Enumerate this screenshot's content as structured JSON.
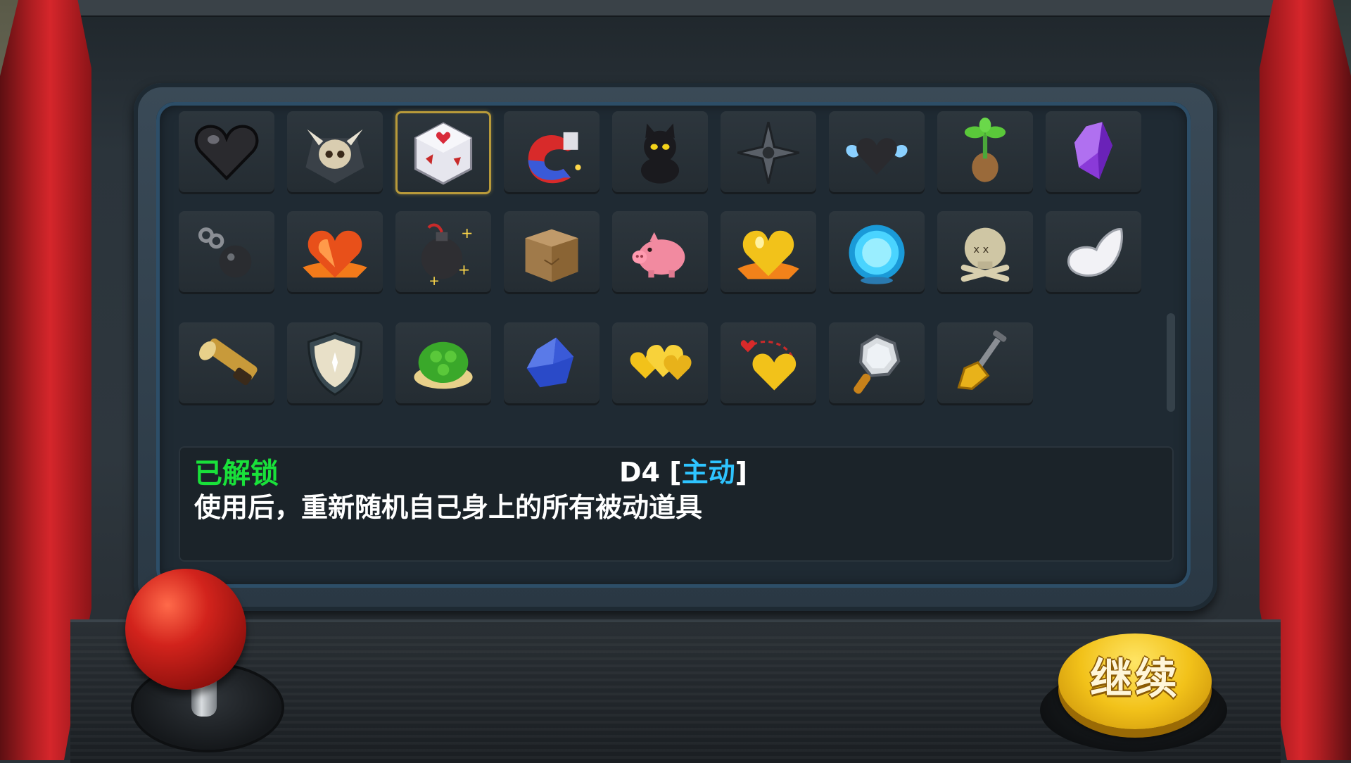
{
  "item_info": {
    "status": "已解锁",
    "name": "D4",
    "bracket_open": " [",
    "type": "主动",
    "bracket_close": "]",
    "description": "使用后，重新随机自己身上的所有被动道具"
  },
  "continue_button": {
    "label": "继续"
  },
  "selected_index": 2,
  "items": [
    "black-heart-icon",
    "horned-skull-icon",
    "d4-dice-icon",
    "magnet-icon",
    "black-cat-icon",
    "shuriken-icon",
    "winged-black-heart-icon",
    "sprout-icon",
    "purple-crystal-icon",
    "ball-and-chain-icon",
    "fire-heart-icon",
    "sparkle-bomb-icon",
    "cardboard-box-icon",
    "piggy-bank-icon",
    "gold-heart-burst-icon",
    "blue-orb-icon",
    "skull-crossbones-icon",
    "white-wing-icon",
    "spyglass-icon",
    "shield-icon",
    "turtle-shell-icon",
    "blue-gem-icon",
    "gold-hearts-icon",
    "gold-heart-orbit-icon",
    "magnifying-glass-icon",
    "shovel-icon"
  ]
}
